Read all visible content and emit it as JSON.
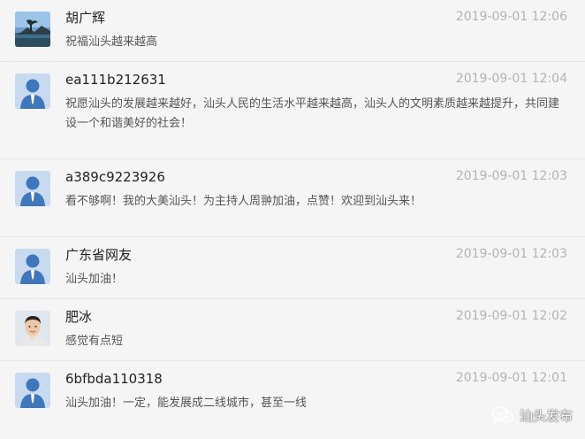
{
  "comments": [
    {
      "user": "胡广辉",
      "time": "2019-09-01 12:06",
      "text": "祝福汕头越来越高",
      "avatar": "landscape-photo-avatar"
    },
    {
      "user": "ea111b212631",
      "time": "2019-09-01 12:04",
      "text": "祝愿汕头的发展越来越好，汕头人民的生活水平越来越高，汕头人的文明素质越来越提升，共同建设一个和谐美好的社会！",
      "avatar": "default-user-avatar"
    },
    {
      "user": "a389c9223926",
      "time": "2019-09-01 12:03",
      "text": "看不够啊！我的大美汕头！为主持人周翀加油，点赞！欢迎到汕头来！",
      "avatar": "default-user-avatar"
    },
    {
      "user": "广东省网友",
      "time": "2019-09-01 12:03",
      "text": "汕头加油！",
      "avatar": "default-user-avatar"
    },
    {
      "user": "肥冰",
      "time": "2019-09-01 12:02",
      "text": "感觉有点短",
      "avatar": "person-photo-avatar"
    },
    {
      "user": "6bfbda110318",
      "time": "2019-09-01 12:01",
      "text": "汕头加油！一定，能发展成二线城市，甚至一线",
      "avatar": "default-user-avatar"
    }
  ],
  "watermark": {
    "label": "汕头发布",
    "icon": "wechat-icon"
  }
}
